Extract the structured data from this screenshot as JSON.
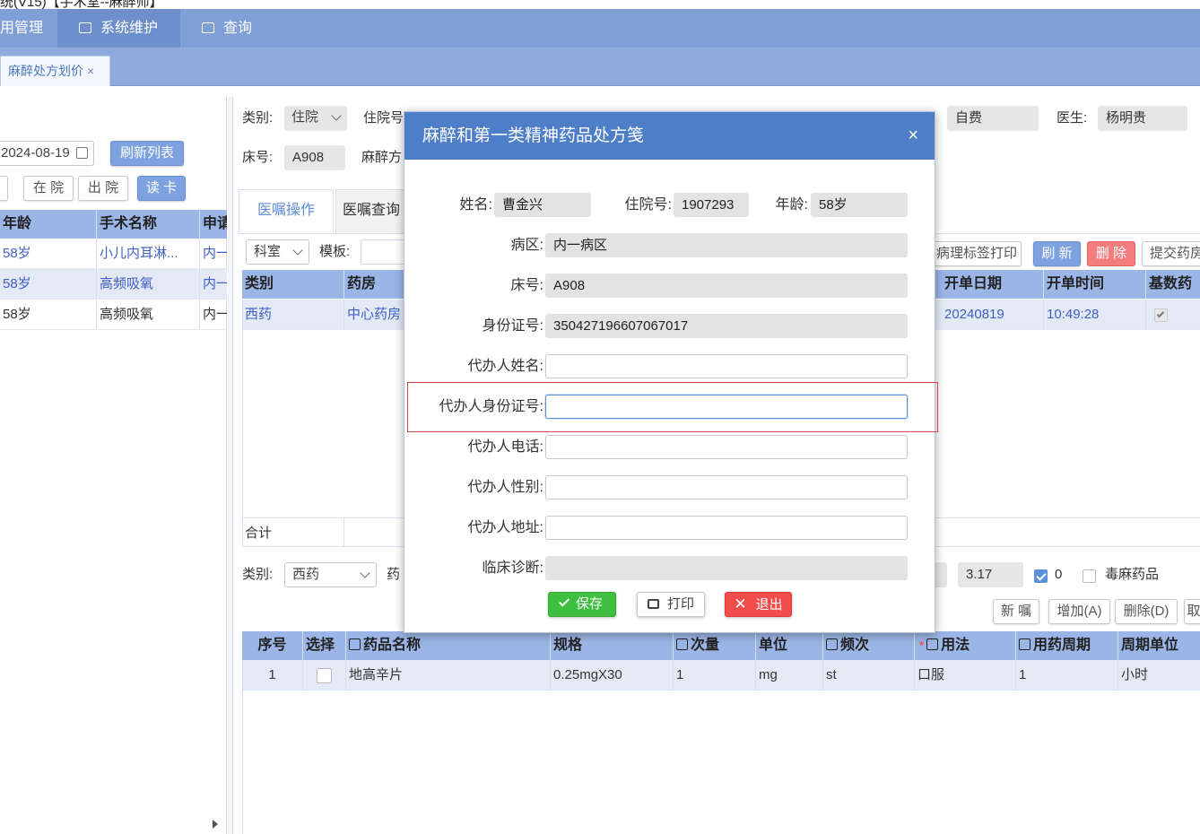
{
  "window": {
    "title_fragment": "统(V15)【手术室--麻醉师】"
  },
  "menu": {
    "items": [
      {
        "label": "用管理",
        "icon": "none"
      },
      {
        "label": "系统维护",
        "icon": "monitor-icon"
      },
      {
        "label": "查询",
        "icon": "search-doc-icon"
      }
    ]
  },
  "tabs": {
    "active": {
      "label": "麻醉处方划价",
      "close": "×"
    }
  },
  "left": {
    "date": "2024-08-19",
    "refresh_btn": "刷新列表",
    "btn_in": "在 院",
    "btn_out": "出 院",
    "btn_read": "读 卡",
    "columns": [
      "年龄",
      "手术名称",
      "申请"
    ],
    "rows": [
      {
        "age": "58岁",
        "surgery": "小儿内耳淋...",
        "dept": "内一"
      },
      {
        "age": "58岁",
        "surgery": "高频吸氧",
        "dept": "内一"
      },
      {
        "age": "58岁",
        "surgery": "高频吸氧",
        "dept": "内一"
      }
    ]
  },
  "main": {
    "category_label": "类别:",
    "category_value": "住院",
    "inpatient_label": "住院号",
    "fee_type": "自费",
    "doctor_label": "医生:",
    "doctor_value": "杨明贵",
    "bed_label": "床号:",
    "bed_value": "A908",
    "anes_label": "麻醉方",
    "subtabs": [
      "医嘱操作",
      "医嘱查询"
    ],
    "dept_select": "科室",
    "template_label": "模板:",
    "print_label_btn": "病理标签打印",
    "refresh_btn": "刷 新",
    "delete_btn": "删 除",
    "submit_btn": "提交药房",
    "grid_columns": [
      "类别",
      "药房",
      "开单日期",
      "开单时间",
      "基数药"
    ],
    "grid_row": {
      "category": "西药",
      "pharmacy": "中心药房",
      "date": "20240819",
      "time": "10:49:28"
    },
    "total_label": "合计",
    "lower_category_label": "类别:",
    "lower_category_value": "西药",
    "drug_label": "药",
    "amount": "3.17",
    "count": "0",
    "poison_label": "毒麻药品",
    "btn_new": "新 嘱",
    "btn_add": "增加(A)",
    "btn_del": "删除(D)",
    "btn_cancel_frag": "取",
    "detail_columns": [
      "序号",
      "选择",
      "药品名称",
      "规格",
      "次量",
      "单位",
      "频次",
      "用法",
      "用药周期",
      "周期单位"
    ],
    "detail_row": {
      "no": "1",
      "name": "地高辛片",
      "spec": "0.25mgX30",
      "dose": "1",
      "unit": "mg",
      "freq": "st",
      "usage": "口服",
      "cycle": "1",
      "cycle_unit": "小时"
    }
  },
  "dialog": {
    "title": "麻醉和第一类精神药品处方笺",
    "close": "×",
    "name_label": "姓名:",
    "name_value": "曹金兴",
    "inpatient_label": "住院号:",
    "inpatient_value": "1907293",
    "age_label": "年龄:",
    "age_value": "58岁",
    "ward_label": "病区:",
    "ward_value": "内一病区",
    "bed_label": "床号:",
    "bed_value": "A908",
    "id_label": "身份证号:",
    "id_value": "350427196607067017",
    "agent_name_label": "代办人姓名:",
    "agent_id_label": "代办人身份证号:",
    "agent_phone_label": "代办人电话:",
    "agent_gender_label": "代办人性别:",
    "agent_addr_label": "代办人地址:",
    "diagnosis_label": "临床诊断:",
    "save_btn": "保存",
    "print_btn": "打印",
    "exit_btn": "退出"
  }
}
